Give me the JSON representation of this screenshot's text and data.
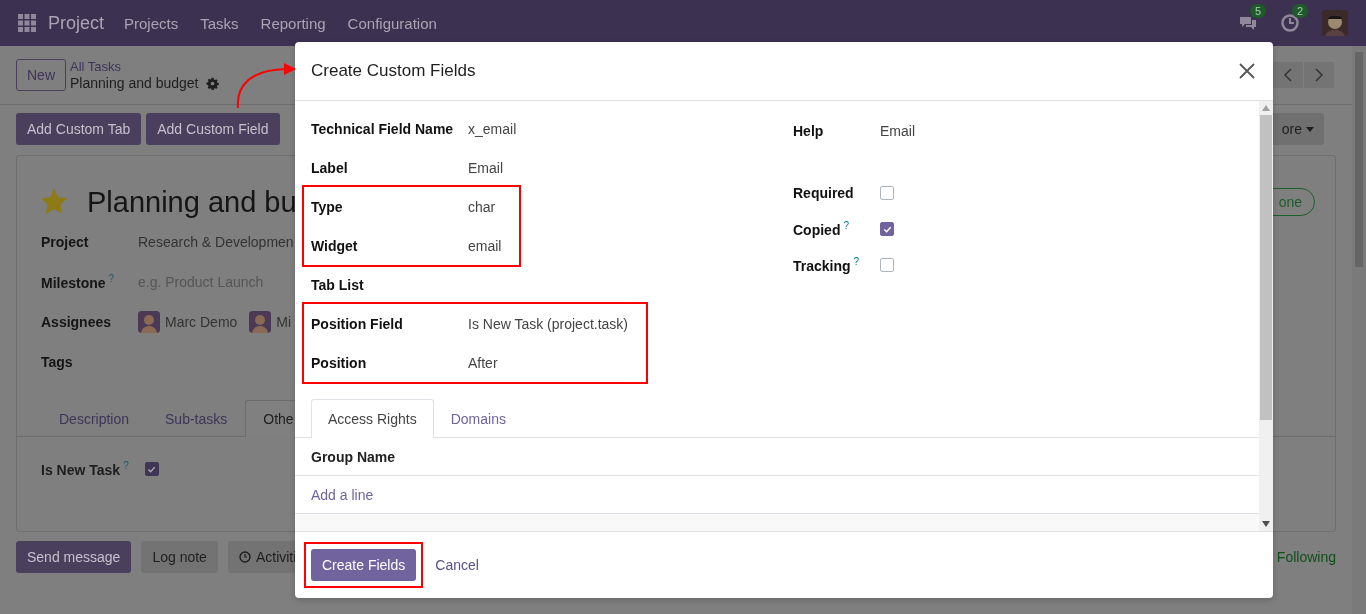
{
  "navbar": {
    "app_name": "Project",
    "menu": [
      "Projects",
      "Tasks",
      "Reporting",
      "Configuration"
    ],
    "messages_count": "5",
    "activities_count": "2"
  },
  "control_panel": {
    "new_button": "New",
    "breadcrumb_parent": "All Tasks",
    "breadcrumb_current": "Planning and budget"
  },
  "action_buttons": [
    "Add Custom Tab",
    "Add Custom Field"
  ],
  "more_button": "ore",
  "task": {
    "starred": true,
    "title": "Planning and bu",
    "stage": "one",
    "fields": [
      {
        "label": "Project",
        "kind": "text",
        "value": "Research & Developmen"
      },
      {
        "label": "Milestone",
        "help": "?",
        "kind": "placeholder",
        "placeholder": "e.g. Product Launch"
      },
      {
        "label": "Assignees",
        "kind": "avatars",
        "people": [
          "Marc Demo",
          "Mi"
        ]
      },
      {
        "label": "Tags",
        "kind": "empty"
      }
    ],
    "tabs": [
      {
        "label": "Description",
        "selected": false
      },
      {
        "label": "Sub-tasks",
        "selected": false
      },
      {
        "label": "Othe",
        "selected": true
      }
    ],
    "tab_fields": [
      {
        "label": "Is New Task",
        "help": "?",
        "checked": true
      }
    ]
  },
  "chatter": {
    "buttons": [
      {
        "label": "Send message",
        "kind": "primary"
      },
      {
        "label": "Log note",
        "kind": "secondary"
      },
      {
        "label": "Activiti",
        "kind": "activity"
      }
    ],
    "follow": "Following"
  },
  "dialog": {
    "title": "Create Custom Fields",
    "field_groups": [
      {
        "highlighted": false,
        "fields": [
          {
            "label": "Technical Field Name",
            "value": "x_email"
          },
          {
            "label": "Label",
            "value": "Email"
          }
        ]
      },
      {
        "highlighted": true,
        "fields": [
          {
            "label": "Type",
            "value": "char"
          },
          {
            "label": "Widget",
            "value": "email"
          }
        ]
      },
      {
        "highlighted": false,
        "fields": [
          {
            "label": "Tab List"
          }
        ]
      },
      {
        "highlighted": true,
        "fields": [
          {
            "label": "Position Field",
            "value": "Is New Task (project.task)"
          },
          {
            "label": "Position",
            "value": "After"
          }
        ]
      }
    ],
    "side_fields": [
      {
        "label": "Help",
        "kind": "text",
        "value": "Email"
      },
      {
        "label": "Required",
        "kind": "checkbox",
        "checked": false
      },
      {
        "label": "Copied",
        "kind": "checkbox",
        "help": "?",
        "checked": true
      },
      {
        "label": "Tracking",
        "kind": "checkbox",
        "help": "?",
        "checked": false
      }
    ],
    "tabs": [
      {
        "label": "Access Rights",
        "selected": true
      },
      {
        "label": "Domains",
        "selected": false
      }
    ],
    "table": {
      "columns": [
        "Group Name"
      ],
      "add_line": "Add a line"
    },
    "footer": [
      {
        "label": "Create Fields",
        "kind": "primary",
        "highlighted": true
      },
      {
        "label": "Cancel",
        "kind": "link",
        "highlighted": false
      }
    ]
  },
  "annotation_arrow": true
}
